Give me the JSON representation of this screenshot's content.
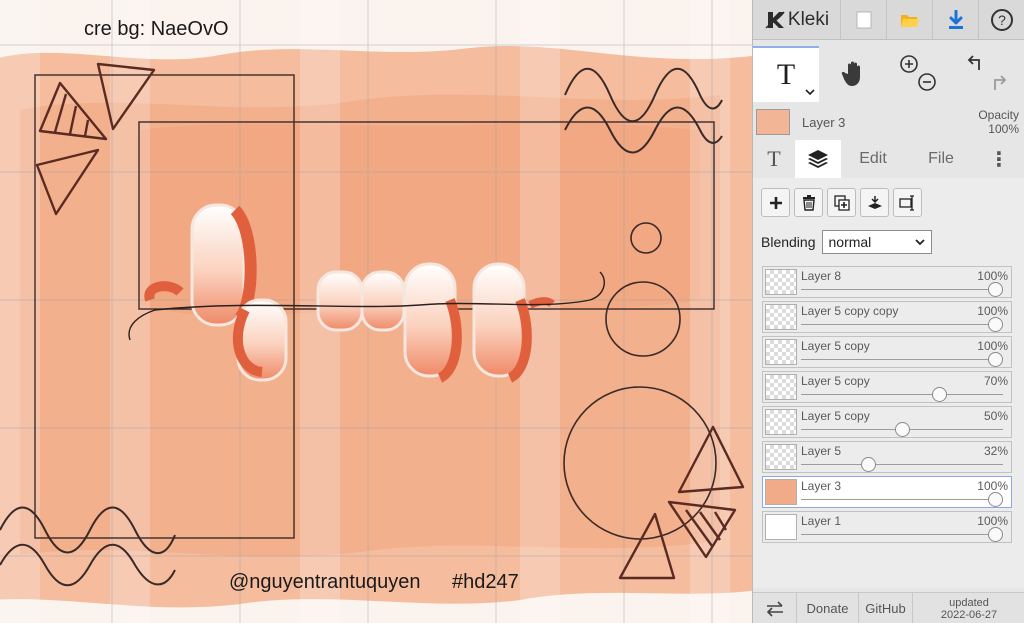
{
  "canvas": {
    "credit_text": "cre bg: NaeOvO",
    "handle_text": "@nguyentrantuquyen",
    "hashtag_text": "#hd247",
    "colors": {
      "peach": "#f2b08d",
      "coral": "#e86a45",
      "line": "#3a2a28"
    }
  },
  "topbar": {
    "app_name": "Kleki",
    "icons": [
      "kleki-logo-icon",
      "new-image-icon",
      "open-folder-icon",
      "download-icon",
      "help-icon"
    ],
    "help_glyph": "?"
  },
  "tools": {
    "text_tool_glyph": "T",
    "icons": [
      "text-tool-icon",
      "hand-tool-icon",
      "zoom-in-icon",
      "zoom-out-icon",
      "undo-icon",
      "redo-icon"
    ]
  },
  "current_layer": {
    "name": "Layer 3",
    "opacity_label": "Opacity",
    "opacity_value": "100%"
  },
  "tabs": {
    "text_glyph": "T",
    "edit": "Edit",
    "file": "File",
    "more_glyph": "⋮"
  },
  "layer_buttons": [
    "add-layer-icon",
    "delete-layer-icon",
    "duplicate-layer-icon",
    "merge-down-icon",
    "rename-layer-icon"
  ],
  "blending": {
    "label": "Blending",
    "value": "normal"
  },
  "layers": [
    {
      "name": "Layer 8",
      "opacity_text": "100%",
      "opacity": 1.0,
      "thumb": "checker",
      "selected": false
    },
    {
      "name": "Layer 5 copy copy",
      "opacity_text": "100%",
      "opacity": 1.0,
      "thumb": "checker",
      "selected": false
    },
    {
      "name": "Layer 5 copy",
      "opacity_text": "100%",
      "opacity": 1.0,
      "thumb": "checker",
      "selected": false
    },
    {
      "name": "Layer 5 copy",
      "opacity_text": "70%",
      "opacity": 0.7,
      "thumb": "checker",
      "selected": false
    },
    {
      "name": "Layer 5 copy",
      "opacity_text": "50%",
      "opacity": 0.5,
      "thumb": "checker",
      "selected": false
    },
    {
      "name": "Layer 5",
      "opacity_text": "32%",
      "opacity": 0.32,
      "thumb": "checker",
      "selected": false
    },
    {
      "name": "Layer 3",
      "opacity_text": "100%",
      "opacity": 1.0,
      "thumb": "peach",
      "selected": true
    },
    {
      "name": "Layer 1",
      "opacity_text": "100%",
      "opacity": 1.0,
      "thumb": "full",
      "selected": false
    }
  ],
  "footer": {
    "donate": "Donate",
    "github": "GitHub",
    "updated_label": "updated",
    "updated_date": "2022-06-27"
  }
}
